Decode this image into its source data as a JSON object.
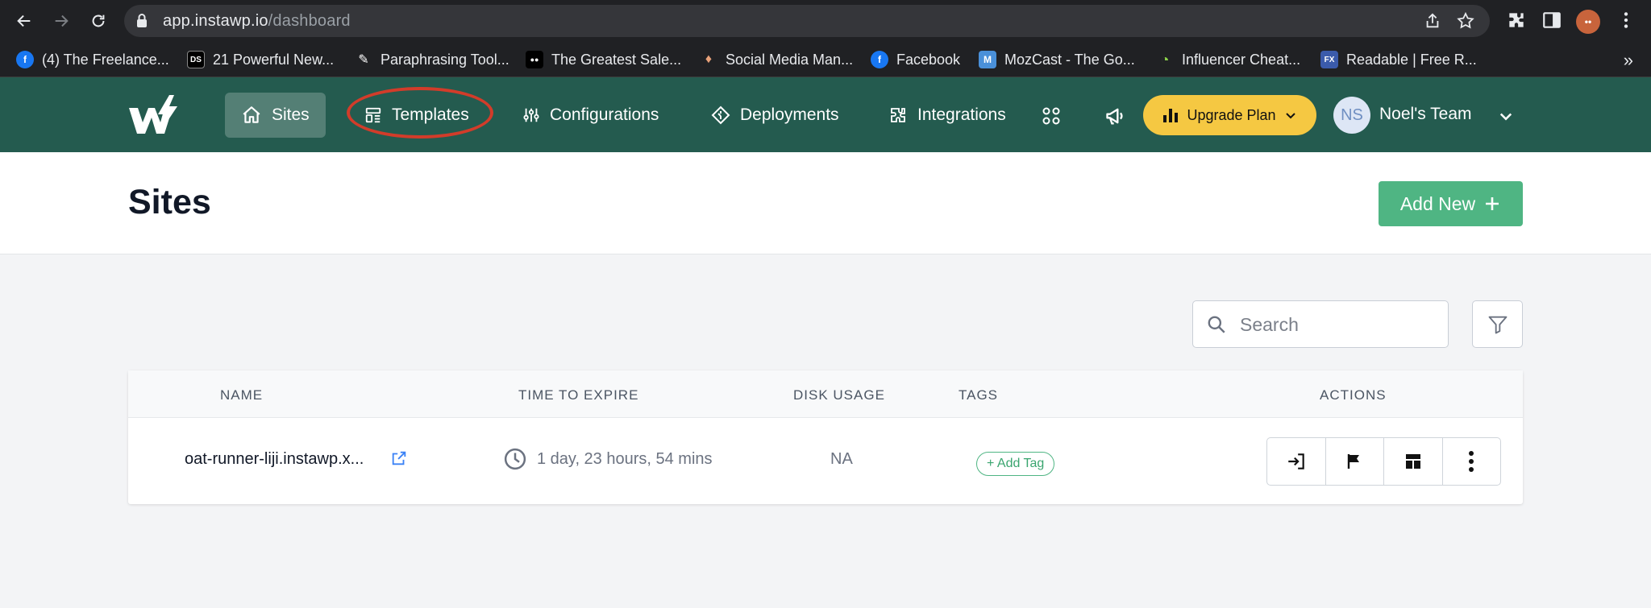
{
  "browser": {
    "url_host": "app.instawp.io",
    "url_path": "/dashboard",
    "profile_initials": "••",
    "bookmarks": [
      {
        "label": "(4) The Freelance...",
        "icon": "facebook-icon",
        "color": "#1877f2",
        "glyph": "f"
      },
      {
        "label": "21 Powerful New...",
        "icon": "ds-icon",
        "color": "#000000",
        "glyph": "DS"
      },
      {
        "label": "Paraphrasing Tool...",
        "icon": "feather-icon",
        "color": "#202124",
        "glyph": "✎"
      },
      {
        "label": "The Greatest Sale...",
        "icon": "medium-icon",
        "color": "#000000",
        "glyph": "●●"
      },
      {
        "label": "Social Media Man...",
        "icon": "drop-icon",
        "color": "#202124",
        "glyph": "♦"
      },
      {
        "label": "Facebook",
        "icon": "facebook-icon",
        "color": "#1877f2",
        "glyph": "f"
      },
      {
        "label": "MozCast - The Go...",
        "icon": "moz-icon",
        "color": "#4a90d9",
        "glyph": "M"
      },
      {
        "label": "Influencer Cheat...",
        "icon": "ring-icon",
        "color": "#202124",
        "glyph": "◔"
      },
      {
        "label": "Readable | Free R...",
        "icon": "fx-icon",
        "color": "#3b5bab",
        "glyph": "FX"
      }
    ],
    "more": "»"
  },
  "header": {
    "nav": [
      {
        "label": "Sites",
        "icon": "home-icon",
        "active": true
      },
      {
        "label": "Templates",
        "icon": "template-icon",
        "active": false
      },
      {
        "label": "Configurations",
        "icon": "sliders-icon",
        "active": false
      },
      {
        "label": "Deployments",
        "icon": "deploy-icon",
        "active": false
      },
      {
        "label": "Integrations",
        "icon": "puzzle-icon",
        "active": false
      }
    ],
    "upgrade_label": "Upgrade Plan",
    "team_initials": "NS",
    "team_name": "Noel's Team"
  },
  "page": {
    "title": "Sites",
    "add_new_label": "Add New"
  },
  "search": {
    "placeholder": "Search"
  },
  "table": {
    "columns": [
      "NAME",
      "TIME TO EXPIRE",
      "DISK USAGE",
      "TAGS",
      "ACTIONS"
    ],
    "rows": [
      {
        "name": "oat-runner-liji.instawp.x...",
        "expire": "1 day, 23 hours, 54 mins",
        "disk": "NA",
        "tag_button": "+ Add Tag"
      }
    ]
  },
  "colors": {
    "header_bg": "#245b4f",
    "accent_green": "#4fb583",
    "upgrade_yellow": "#f5c842",
    "highlight_red": "#d23c2a"
  }
}
